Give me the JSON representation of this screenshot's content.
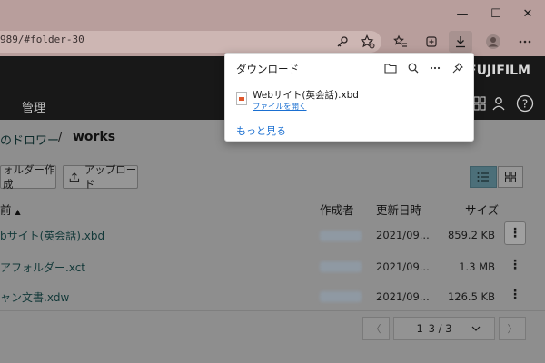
{
  "browser": {
    "address": "989/#folder-30",
    "window_buttons": {
      "minimize": "—",
      "maximize": "☐",
      "close": "✕"
    }
  },
  "download_panel": {
    "title": "ダウンロード",
    "item_name": "Webサイト(英会話).xbd",
    "open_file_link": "ファイルを開く",
    "show_more": "もっと見る"
  },
  "app": {
    "brand": "FUJIFILM",
    "nav_manage": "管理"
  },
  "breadcrumb": {
    "parent": "のドロワー",
    "separator": "/",
    "current": "works"
  },
  "toolbar": {
    "new_folder": "ォルダー作成",
    "upload": "アップロード"
  },
  "table": {
    "columns": {
      "name": "前",
      "creator": "作成者",
      "updated": "更新日時",
      "size": "サイズ"
    },
    "rows": [
      {
        "name": "bサイト(英会話).xbd",
        "updated": "2021/09...",
        "size": "859.2 KB"
      },
      {
        "name": "アフォルダー.xct",
        "updated": "2021/09...",
        "size": "1.3 MB"
      },
      {
        "name": "ャン文書.xdw",
        "updated": "2021/09...",
        "size": "126.5 KB"
      }
    ]
  },
  "pagination": {
    "current": "1–3 / 3"
  },
  "colors": {
    "accent_link": "#1a6fd1",
    "active_view": "#4c6f79"
  }
}
